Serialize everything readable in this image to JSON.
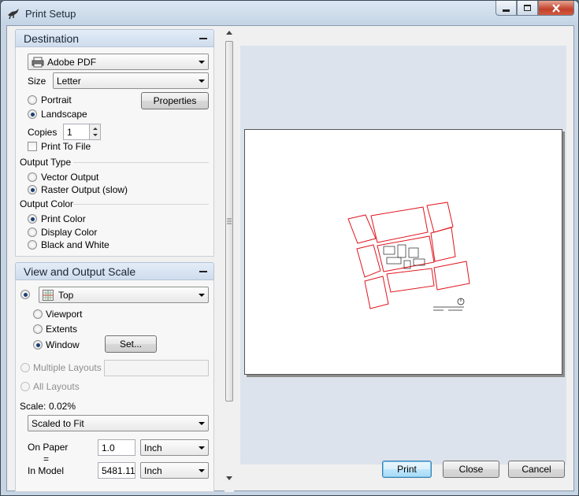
{
  "window": {
    "title": "Print Setup"
  },
  "destination": {
    "header": "Destination",
    "printer": "Adobe PDF",
    "size_label": "Size",
    "size": "Letter",
    "orientation": {
      "portrait": "Portrait",
      "landscape": "Landscape",
      "selected": "landscape"
    },
    "properties_button": "Properties",
    "copies_label": "Copies",
    "copies": "1",
    "print_to_file": "Print To File",
    "output_type": {
      "label": "Output Type",
      "vector": "Vector Output",
      "raster": "Raster Output (slow)",
      "selected": "raster"
    },
    "output_color": {
      "label": "Output Color",
      "print": "Print Color",
      "display": "Display Color",
      "bw": "Black and White",
      "selected": "print"
    }
  },
  "view_scale": {
    "header": "View and Output Scale",
    "view": "Top",
    "viewport": "Viewport",
    "extents": "Extents",
    "window": "Window",
    "set_button": "Set...",
    "multiple_layouts": "Multiple Layouts",
    "all_layouts": "All Layouts",
    "scale_label": "Scale:",
    "scale_value": "0.02%",
    "scale_mode": "Scaled to Fit",
    "on_paper_label": "On Paper",
    "equals": "=",
    "in_model_label": "In Model",
    "on_paper_value": "1.0",
    "on_paper_unit": "Inch",
    "in_model_value": "5481.11!",
    "in_model_unit": "Inch"
  },
  "buttons": {
    "print": "Print",
    "close": "Close",
    "cancel": "Cancel"
  },
  "colors": {
    "drawing": "#e0161e",
    "accent": "#1b3f73"
  }
}
